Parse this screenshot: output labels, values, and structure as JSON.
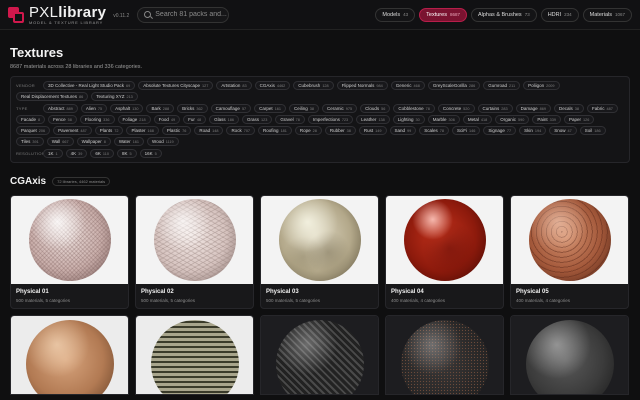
{
  "app": {
    "logo_title_a": "PXL",
    "logo_title_b": "library",
    "logo_subtitle": "MODEL & TEXTURE LIBRARY",
    "version": "v0.11.2"
  },
  "search": {
    "placeholder": "Search 81 packs and..."
  },
  "nav": [
    {
      "label": "Models",
      "count": "43",
      "active": false
    },
    {
      "label": "Textures",
      "count": "8687",
      "active": true
    },
    {
      "label": "Alphas & Brushes",
      "count": "73",
      "active": false
    },
    {
      "label": "HDRI",
      "count": "234",
      "active": false
    },
    {
      "label": "Materials",
      "count": "1067",
      "active": false
    }
  ],
  "main": {
    "title": "Textures",
    "subtitle": "8687 materials across 28 libraries and 336 categories."
  },
  "filters": {
    "vendor_label": "VENDOR",
    "vendor": [
      {
        "l": "3D Collective - Real Light Studio Pack",
        "n": "69"
      },
      {
        "l": "Absolute Textures Cityscape",
        "n": "127"
      },
      {
        "l": "Artstation",
        "n": "83"
      },
      {
        "l": "CGAxis",
        "n": "4462"
      },
      {
        "l": "Cubebrush",
        "n": "128"
      },
      {
        "l": "Flipped Normals",
        "n": "984"
      },
      {
        "l": "Generic",
        "n": "468"
      },
      {
        "l": "GreyScaleGorilla",
        "n": "286"
      },
      {
        "l": "Gumroad",
        "n": "211"
      },
      {
        "l": "Poliigon",
        "n": "2009"
      },
      {
        "l": "Real Displacement Textures",
        "n": "86"
      },
      {
        "l": "Texturing XYZ",
        "n": "213"
      }
    ],
    "type_label": "TYPE",
    "type": [
      {
        "l": "Abstract",
        "n": "889"
      },
      {
        "l": "Alien",
        "n": "75"
      },
      {
        "l": "Asphalt",
        "n": "130"
      },
      {
        "l": "Bark",
        "n": "288"
      },
      {
        "l": "Bricks",
        "n": "362"
      },
      {
        "l": "Camouflage",
        "n": "57"
      },
      {
        "l": "Carpet",
        "n": "161"
      },
      {
        "l": "Ceiling",
        "n": "38"
      },
      {
        "l": "Ceramic",
        "n": "975"
      },
      {
        "l": "Clouds",
        "n": "56"
      },
      {
        "l": "Cobblestone",
        "n": "78"
      },
      {
        "l": "Concrete",
        "n": "520"
      },
      {
        "l": "Curtains",
        "n": "283"
      },
      {
        "l": "Damage",
        "n": "869"
      },
      {
        "l": "Decals",
        "n": "38"
      },
      {
        "l": "Fabric",
        "n": "487"
      },
      {
        "l": "Facade",
        "n": "8"
      },
      {
        "l": "Fence",
        "n": "58"
      },
      {
        "l": "Flooring",
        "n": "336"
      },
      {
        "l": "Foliage",
        "n": "218"
      },
      {
        "l": "Food",
        "n": "49"
      },
      {
        "l": "Fur",
        "n": "48"
      },
      {
        "l": "Glass",
        "n": "186"
      },
      {
        "l": "Grass",
        "n": "123"
      },
      {
        "l": "Gravel",
        "n": "78"
      },
      {
        "l": "Imperfections",
        "n": "723"
      },
      {
        "l": "Leather",
        "n": "138"
      },
      {
        "l": "Lighting",
        "n": "30"
      },
      {
        "l": "Marble",
        "n": "306"
      },
      {
        "l": "Metal",
        "n": "418"
      },
      {
        "l": "Organic",
        "n": "590"
      },
      {
        "l": "Paint",
        "n": "339"
      },
      {
        "l": "Paper",
        "n": "126"
      },
      {
        "l": "Parquet",
        "n": "206"
      },
      {
        "l": "Pavement",
        "n": "487"
      },
      {
        "l": "Plants",
        "n": "72"
      },
      {
        "l": "Plaster",
        "n": "168"
      },
      {
        "l": "Plastic",
        "n": "76"
      },
      {
        "l": "Road",
        "n": "148"
      },
      {
        "l": "Rock",
        "n": "707"
      },
      {
        "l": "Roofing",
        "n": "181"
      },
      {
        "l": "Rope",
        "n": "28"
      },
      {
        "l": "Rubber",
        "n": "38"
      },
      {
        "l": "Rust",
        "n": "149"
      },
      {
        "l": "Sand",
        "n": "99"
      },
      {
        "l": "Scales",
        "n": "78"
      },
      {
        "l": "SciFi",
        "n": "146"
      },
      {
        "l": "Signage",
        "n": "77"
      },
      {
        "l": "Skin",
        "n": "194"
      },
      {
        "l": "Snow",
        "n": "47"
      },
      {
        "l": "Soil",
        "n": "186"
      },
      {
        "l": "Tiles",
        "n": "391"
      },
      {
        "l": "Wall",
        "n": "667"
      },
      {
        "l": "Wallpaper",
        "n": "8"
      },
      {
        "l": "Water",
        "n": "161"
      },
      {
        "l": "Wood",
        "n": "1119"
      }
    ],
    "resolution_label": "RESOLUTION",
    "resolution": [
      {
        "l": "1K",
        "n": "1"
      },
      {
        "l": "4K",
        "n": "39"
      },
      {
        "l": "6K",
        "n": "110"
      },
      {
        "l": "8K",
        "n": "5"
      },
      {
        "l": "16K",
        "n": "5"
      }
    ]
  },
  "section": {
    "title": "CGAxis",
    "badge": "72 libraries, 4462 materials"
  },
  "cards": [
    {
      "title": "Physical 01",
      "meta": "500 materials, 5 categories",
      "texture": "s1"
    },
    {
      "title": "Physical 02",
      "meta": "500 materials, 5 categories",
      "texture": "s2"
    },
    {
      "title": "Physical 03",
      "meta": "500 materials, 5 categories",
      "texture": "s3"
    },
    {
      "title": "Physical 04",
      "meta": "400 materials, 4 categories",
      "texture": "s4"
    },
    {
      "title": "Physical 05",
      "meta": "400 materials, 4 categories",
      "texture": "s5"
    }
  ],
  "cards_row2": [
    {
      "texture": "t1",
      "bg": "light"
    },
    {
      "texture": "t2",
      "bg": "light"
    },
    {
      "texture": "t3",
      "bg": "dark"
    },
    {
      "texture": "t4",
      "bg": "dark"
    },
    {
      "texture": "t5",
      "bg": "dark"
    }
  ],
  "colors": {
    "accent": "#d0184c",
    "active_tab": "#7a1330",
    "background": "#0f0f10"
  }
}
